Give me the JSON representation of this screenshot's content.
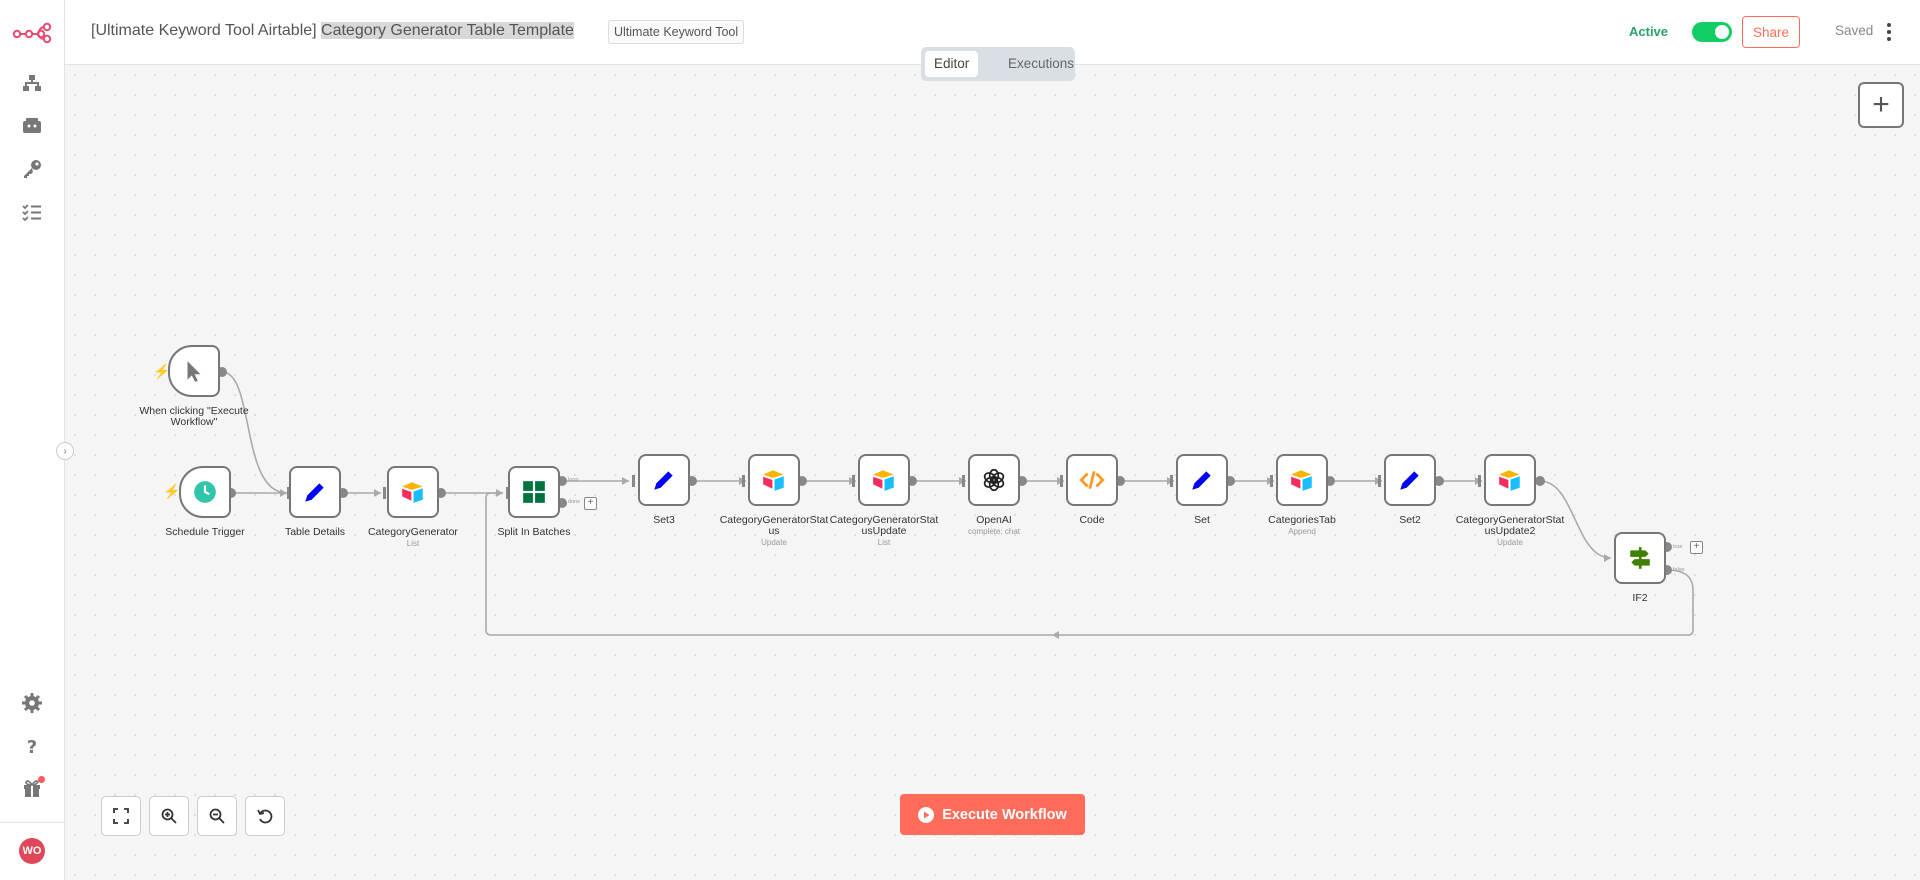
{
  "header": {
    "title_prefix": "[Ultimate Keyword Tool Airtable] ",
    "title_highlight": "Category Generator Table Template",
    "tag": "Ultimate Keyword Tool",
    "active_label": "Active",
    "active": true,
    "share_label": "Share",
    "saved_label": "Saved"
  },
  "tabs": {
    "editor": "Editor",
    "executions": "Executions"
  },
  "sidebar": {
    "items": [
      "workflows-icon",
      "templates-icon",
      "credentials-icon",
      "executions-icon"
    ],
    "bottom": [
      "settings-icon",
      "help-icon",
      "gift-icon"
    ],
    "avatar": "WO"
  },
  "nodes": {
    "manual_trigger": {
      "label": "When clicking \"Execute Workflow\""
    },
    "schedule": {
      "label": "Schedule Trigger"
    },
    "table_details": {
      "label": "Table Details"
    },
    "category_generator": {
      "label": "CategoryGenerator",
      "sub": "List"
    },
    "split_batches": {
      "label": "Split In Batches",
      "port_loop": "loop",
      "port_done": "done"
    },
    "set3": {
      "label": "Set3"
    },
    "cg_status": {
      "label": "CategoryGeneratorStat us",
      "sub": "Update"
    },
    "cg_status_update": {
      "label": "CategoryGeneratorStat usUpdate",
      "sub": "List"
    },
    "openai": {
      "label": "OpenAI",
      "sub": "complete: chat"
    },
    "code": {
      "label": "Code"
    },
    "set": {
      "label": "Set"
    },
    "categories_tab": {
      "label": "CategoriesTab",
      "sub": "Append"
    },
    "set2": {
      "label": "Set2"
    },
    "cg_status_update2": {
      "label": "CategoryGeneratorStat usUpdate2",
      "sub": "Update"
    },
    "if2": {
      "label": "IF2",
      "port_true": "true",
      "port_false": "false"
    }
  },
  "execute_label": "Execute Workflow",
  "colors": {
    "accent": "#ff6d5a",
    "active": "#13ce66",
    "set": "#0000ff",
    "airtable": "#fcb400",
    "code": "#ff9922",
    "split": "#00733f",
    "if": "#408000"
  }
}
